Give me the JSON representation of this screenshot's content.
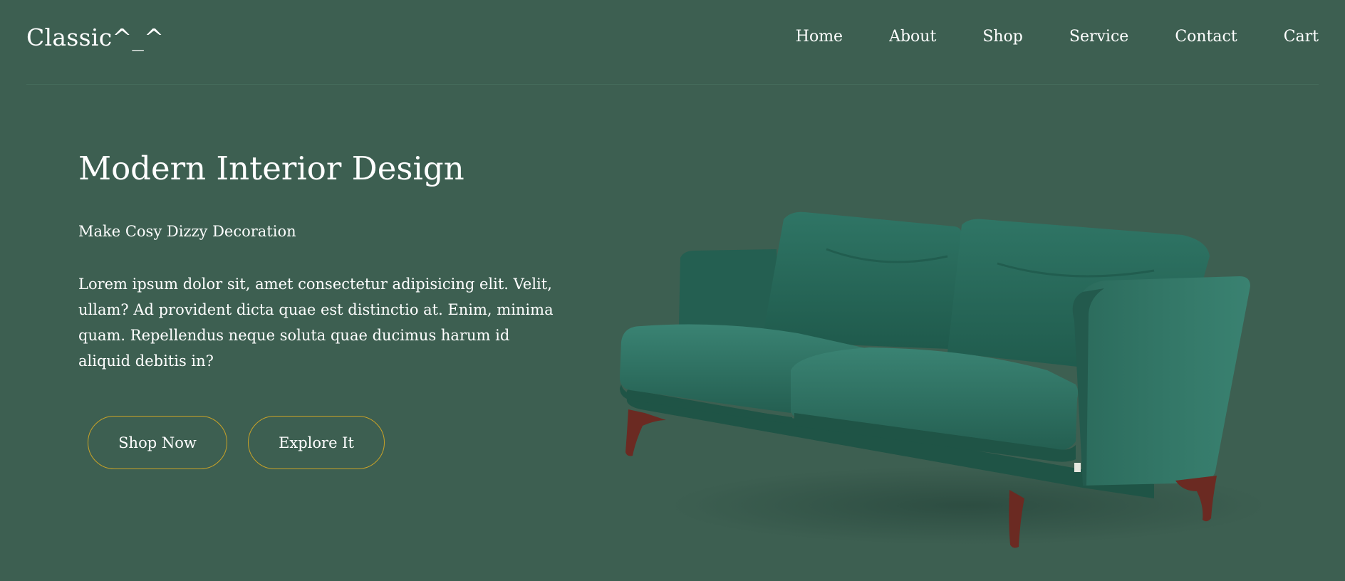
{
  "brand": {
    "logo": "Classic^_^"
  },
  "nav": {
    "items": [
      {
        "label": "Home"
      },
      {
        "label": "About"
      },
      {
        "label": "Shop"
      },
      {
        "label": "Service"
      },
      {
        "label": "Contact"
      },
      {
        "label": "Cart"
      }
    ]
  },
  "hero": {
    "title": "Modern Interior Design",
    "subtitle": "Make Cosy Dizzy Decoration",
    "body": "Lorem ipsum dolor sit, amet consectetur adipisicing elit. Velit, ullam? Ad provident dicta quae est distinctio at. Enim, minima quam. Repellendus neque soluta quae ducimus harum id aliquid debitis in?",
    "primary_button": "Shop Now",
    "secondary_button": "Explore It",
    "image": "green-velvet-sofa"
  },
  "colors": {
    "background": "#3d5f51",
    "text": "#ffffff",
    "button_border": "#c9a227",
    "sofa": "#2e6b5c",
    "sofa_legs": "#6b2a22"
  }
}
